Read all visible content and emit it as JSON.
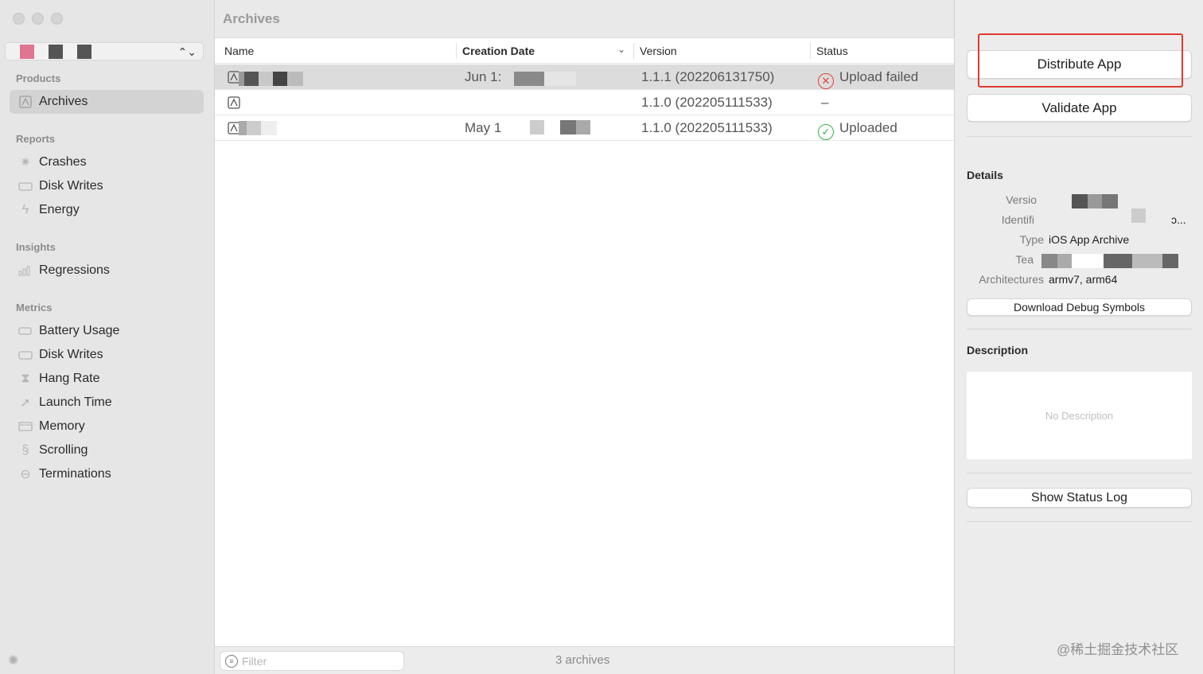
{
  "sidebar": {
    "products_title": "Products",
    "archives_label": "Archives",
    "reports_title": "Reports",
    "reports": [
      "Crashes",
      "Disk Writes",
      "Energy"
    ],
    "insights_title": "Insights",
    "insights": [
      "Regressions"
    ],
    "metrics_title": "Metrics",
    "metrics": [
      "Battery Usage",
      "Disk Writes",
      "Hang Rate",
      "Launch Time",
      "Memory",
      "Scrolling",
      "Terminations"
    ]
  },
  "main": {
    "title": "Archives",
    "columns": {
      "name": "Name",
      "creation_date": "Creation Date",
      "version": "Version",
      "status": "Status"
    },
    "rows": [
      {
        "date": "Jun 1:",
        "version": "1.1.1 (202206131750)",
        "status": "Upload failed",
        "status_type": "failed"
      },
      {
        "date": "",
        "version": "1.1.0 (202205111533)",
        "status": "–",
        "status_type": "none"
      },
      {
        "date": "May 1",
        "version": "1.1.0 (202205111533)",
        "status": "Uploaded",
        "status_type": "uploaded"
      }
    ],
    "filter_placeholder": "Filter",
    "archive_count": "3 archives"
  },
  "inspector": {
    "distribute_label": "Distribute App",
    "validate_label": "Validate App",
    "details_title": "Details",
    "version_key": "Versio",
    "identifier_key": "Identifi",
    "identifier_tail": "ɔ...",
    "type_key": "Type",
    "type_value": "iOS App Archive",
    "team_key": "Tea",
    "arch_key": "Architectures",
    "arch_value": "armv7, arm64",
    "download_label": "Download Debug Symbols",
    "description_title": "Description",
    "description_placeholder": "No Description",
    "status_log_label": "Show Status Log"
  },
  "colors": {
    "highlight": "#e03a30",
    "fail": "#e0453a",
    "ok": "#37b24d",
    "selected_row": "#dcdcdc"
  },
  "watermark": "@稀土掘金技术社区"
}
